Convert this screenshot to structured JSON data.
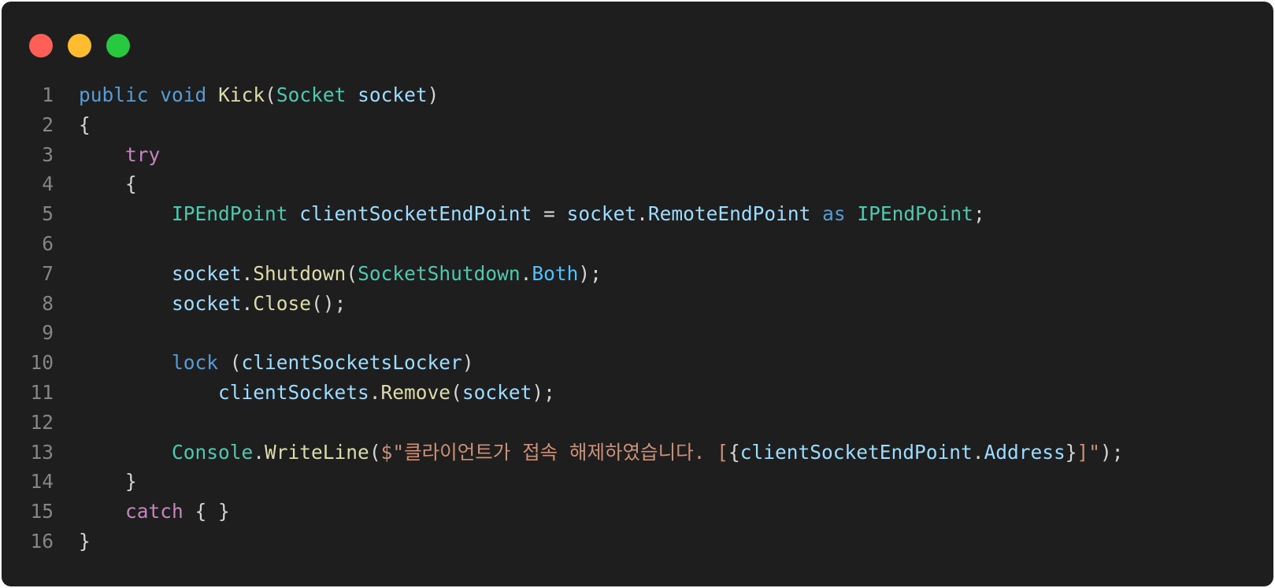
{
  "window": {
    "controls": [
      {
        "name": "close",
        "color": "#ff5f57"
      },
      {
        "name": "minimize",
        "color": "#febc2e"
      },
      {
        "name": "maximize",
        "color": "#28c840"
      }
    ]
  },
  "code": {
    "lines": [
      {
        "n": "1",
        "tokens": [
          [
            "kw",
            "public"
          ],
          [
            "pun",
            " "
          ],
          [
            "kw",
            "void"
          ],
          [
            "pun",
            " "
          ],
          [
            "fn",
            "Kick"
          ],
          [
            "pun",
            "("
          ],
          [
            "type",
            "Socket"
          ],
          [
            "pun",
            " "
          ],
          [
            "var",
            "socket"
          ],
          [
            "pun",
            ")"
          ]
        ]
      },
      {
        "n": "2",
        "tokens": [
          [
            "pun",
            "{"
          ]
        ]
      },
      {
        "n": "3",
        "tokens": [
          [
            "pun",
            "    "
          ],
          [
            "ctl",
            "try"
          ]
        ]
      },
      {
        "n": "4",
        "tokens": [
          [
            "pun",
            "    {"
          ]
        ]
      },
      {
        "n": "5",
        "tokens": [
          [
            "pun",
            "        "
          ],
          [
            "type",
            "IPEndPoint"
          ],
          [
            "pun",
            " "
          ],
          [
            "var",
            "clientSocketEndPoint"
          ],
          [
            "pun",
            " = "
          ],
          [
            "var",
            "socket"
          ],
          [
            "pun",
            "."
          ],
          [
            "var",
            "RemoteEndPoint"
          ],
          [
            "pun",
            " "
          ],
          [
            "kw",
            "as"
          ],
          [
            "pun",
            " "
          ],
          [
            "type",
            "IPEndPoint"
          ],
          [
            "pun",
            ";"
          ]
        ]
      },
      {
        "n": "6",
        "tokens": []
      },
      {
        "n": "7",
        "tokens": [
          [
            "pun",
            "        "
          ],
          [
            "var",
            "socket"
          ],
          [
            "pun",
            "."
          ],
          [
            "fn",
            "Shutdown"
          ],
          [
            "pun",
            "("
          ],
          [
            "type",
            "SocketShutdown"
          ],
          [
            "pun",
            "."
          ],
          [
            "prop",
            "Both"
          ],
          [
            "pun",
            ");"
          ]
        ]
      },
      {
        "n": "8",
        "tokens": [
          [
            "pun",
            "        "
          ],
          [
            "var",
            "socket"
          ],
          [
            "pun",
            "."
          ],
          [
            "fn",
            "Close"
          ],
          [
            "pun",
            "();"
          ]
        ]
      },
      {
        "n": "9",
        "tokens": []
      },
      {
        "n": "10",
        "tokens": [
          [
            "pun",
            "        "
          ],
          [
            "kw",
            "lock"
          ],
          [
            "pun",
            " ("
          ],
          [
            "var",
            "clientSocketsLocker"
          ],
          [
            "pun",
            ")"
          ]
        ]
      },
      {
        "n": "11",
        "tokens": [
          [
            "pun",
            "            "
          ],
          [
            "var",
            "clientSockets"
          ],
          [
            "pun",
            "."
          ],
          [
            "fn",
            "Remove"
          ],
          [
            "pun",
            "("
          ],
          [
            "var",
            "socket"
          ],
          [
            "pun",
            ");"
          ]
        ]
      },
      {
        "n": "12",
        "tokens": []
      },
      {
        "n": "13",
        "tokens": [
          [
            "pun",
            "        "
          ],
          [
            "type",
            "Console"
          ],
          [
            "pun",
            "."
          ],
          [
            "fn",
            "WriteLine"
          ],
          [
            "pun",
            "("
          ],
          [
            "str",
            "$\"클라이언트가 접속 해제하였습니다. ["
          ],
          [
            "pun",
            "{"
          ],
          [
            "var",
            "clientSocketEndPoint"
          ],
          [
            "pun",
            "."
          ],
          [
            "var",
            "Address"
          ],
          [
            "pun",
            "}"
          ],
          [
            "str",
            "]\""
          ],
          [
            "pun",
            ");"
          ]
        ]
      },
      {
        "n": "14",
        "tokens": [
          [
            "pun",
            "    }"
          ]
        ]
      },
      {
        "n": "15",
        "tokens": [
          [
            "pun",
            "    "
          ],
          [
            "ctl",
            "catch"
          ],
          [
            "pun",
            " { }"
          ]
        ]
      },
      {
        "n": "16",
        "tokens": [
          [
            "pun",
            "}"
          ]
        ]
      }
    ]
  }
}
